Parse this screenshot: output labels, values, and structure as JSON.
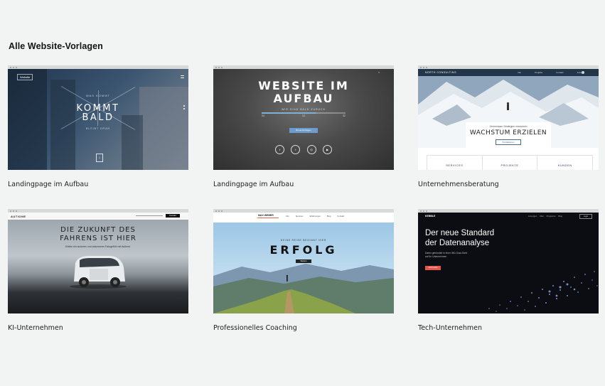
{
  "page": {
    "heading": "Alle Website-Vorlagen"
  },
  "templates": [
    {
      "label": "Landingpage im Aufbau",
      "thumb": {
        "logo": "Website",
        "kicker": "WAS KOMMT",
        "title_line1": "KOMMT",
        "title_line2": "BALD",
        "tagline": "BLEIBT DRAN"
      }
    },
    {
      "label": "Landingpage im Aufbau",
      "thumb": {
        "title_line1": "WEBSITE IM",
        "title_line2": "AUFBAU",
        "subtitle": "WIR SIND BALD ZURÜCK",
        "countdown": [
          "04",
          "12",
          "32"
        ],
        "button": "Benachrichtigen",
        "social": [
          "f",
          "t",
          "◎",
          "▶"
        ]
      }
    },
    {
      "label": "Unternehmensberatung",
      "thumb": {
        "brand": "NORTH CONSULTING",
        "nav": [
          "Info",
          "Projekte",
          "Kontakt",
          "Jobs"
        ],
        "card_kicker": "Gemeinsam Strategien entwickeln",
        "card_title": "WACHSTUM ERZIELEN",
        "card_button": "Kontaktieren",
        "tabs": [
          "SERVICES",
          "PROJEKTE",
          "KUNDEN"
        ]
      }
    },
    {
      "label": "KI-Unternehmen",
      "thumb": {
        "brand": "AUTIONE",
        "button": "Kontakt",
        "title_line1": "DIE ZUKUNFT DES",
        "title_line2": "FAHRENS IST HIER",
        "subtitle": "Erlebe ein sicheres und autonomes Fahrgefühl mit Autione."
      }
    },
    {
      "label": "Professionelles Coaching",
      "thumb": {
        "brand": "MAX WEBER",
        "nav": [
          "Info",
          "Services",
          "Erfahrungen",
          "Blog",
          "Kontakt"
        ],
        "kicker": "DEINE REISE BEGINNT HIER",
        "title": "ERFOLG",
        "button": "Starten"
      }
    },
    {
      "label": "Tech-Unternehmen",
      "thumb": {
        "brand": "KEBBLE",
        "nav": [
          "Lösungen",
          "Über",
          "Programm",
          "Blog"
        ],
        "login": "Login",
        "title_line1": "Der neue Standard",
        "title_line2": "der Datenanalyse",
        "subtitle": "Daten gebündelt in einer 360-Grad-Sicht auf Ihr Unternehmen",
        "button": "Jetzt testen"
      }
    }
  ]
}
